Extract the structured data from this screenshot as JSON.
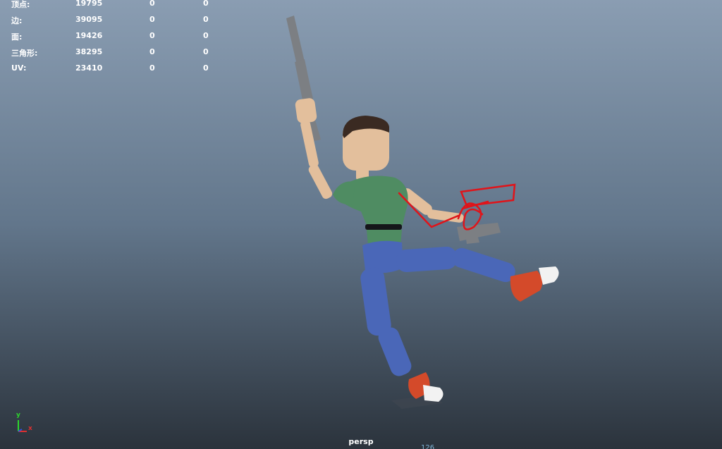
{
  "hud": {
    "rows": [
      {
        "label": "顶点:",
        "value": "19795",
        "selected": "0",
        "uv_selected": "0"
      },
      {
        "label": "边:",
        "value": "39095",
        "selected": "0",
        "uv_selected": "0"
      },
      {
        "label": "面:",
        "value": "19426",
        "selected": "0",
        "uv_selected": "0"
      },
      {
        "label": "三角形:",
        "value": "38295",
        "selected": "0",
        "uv_selected": "0"
      },
      {
        "label": "UV:",
        "value": "23410",
        "selected": "0",
        "uv_selected": "0"
      }
    ]
  },
  "viewport": {
    "camera": "persp",
    "frame": "126",
    "background_top": "#8a9db2",
    "background_bottom": "#2b333c"
  },
  "axis": {
    "y_label": "y",
    "x_label": "x",
    "y_color": "#2dd62d",
    "x_color": "#e03030",
    "z_color": "#3050e0"
  },
  "character": {
    "skin_color": "#e3bf9c",
    "hair_color": "#3a2a22",
    "shirt_color": "#4f8c62",
    "pants_color": "#4a67b8",
    "shoe_color": "#d44a2a",
    "shoe_toe_color": "#f2f2f2",
    "weapon_color": "#7c7f83",
    "sketch_color": "#e0141a"
  }
}
